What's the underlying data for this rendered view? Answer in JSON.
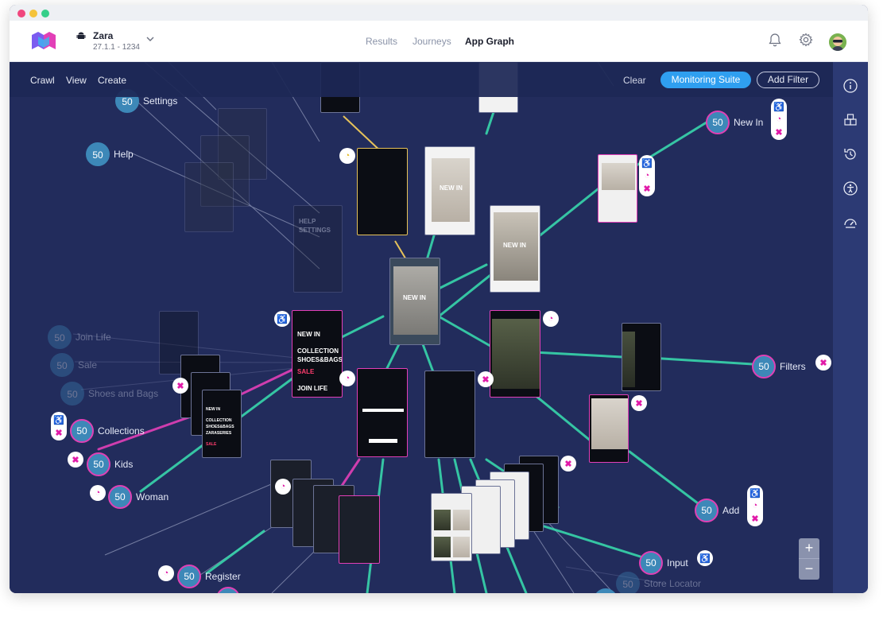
{
  "app": {
    "name": "Zara",
    "version": "27.1.1 - 1234"
  },
  "nav": {
    "tabs": [
      {
        "label": "Results",
        "active": false
      },
      {
        "label": "Journeys",
        "active": false
      },
      {
        "label": "App Graph",
        "active": true
      }
    ]
  },
  "header_icons": [
    "bell-icon",
    "gear-icon",
    "avatar"
  ],
  "toolbar": {
    "menu": [
      "Crawl",
      "View",
      "Create"
    ],
    "clear_label": "Clear",
    "monitoring_label": "Monitoring Suite",
    "add_filter_label": "Add Filter"
  },
  "right_panel_icons": [
    "info-icon",
    "boxes-icon",
    "history-icon",
    "accessibility-icon",
    "performance-icon"
  ],
  "zoom": {
    "in_label": "+",
    "out_label": "−"
  },
  "colors": {
    "canvas": "#222c5c",
    "edge_green": "#39e0b0",
    "edge_pink": "#e23fb7",
    "edge_yellow": "#e6c25a",
    "node_blue": "#3d88b8",
    "accent_blue": "#2f9ff0"
  },
  "graph_nodes": [
    {
      "count": "50",
      "label": "Settings"
    },
    {
      "count": "50",
      "label": "Help"
    },
    {
      "count": "50",
      "label": "New In"
    },
    {
      "count": "50",
      "label": "Join Life"
    },
    {
      "count": "50",
      "label": "Sale"
    },
    {
      "count": "50",
      "label": "Shoes and Bags"
    },
    {
      "count": "50",
      "label": "Collections"
    },
    {
      "count": "50",
      "label": "Kids"
    },
    {
      "count": "50",
      "label": "Woman"
    },
    {
      "count": "50",
      "label": "Filters"
    },
    {
      "count": "50",
      "label": "Add"
    },
    {
      "count": "50",
      "label": "Input"
    },
    {
      "count": "50",
      "label": "Store Locator"
    },
    {
      "count": "50",
      "label": "Register"
    }
  ],
  "screens": {
    "new_in": "NEW IN",
    "help": [
      "HELP",
      "SETTINGS"
    ],
    "menu": [
      "NEW IN",
      "COLLECTION",
      "SHOES&BAGS",
      "SALE",
      "JOIN LIFE"
    ],
    "menu_small": [
      "NEW IN",
      "COLLECTION",
      "SHOES&BAGS",
      "ZARASERIES",
      "SALE"
    ]
  }
}
